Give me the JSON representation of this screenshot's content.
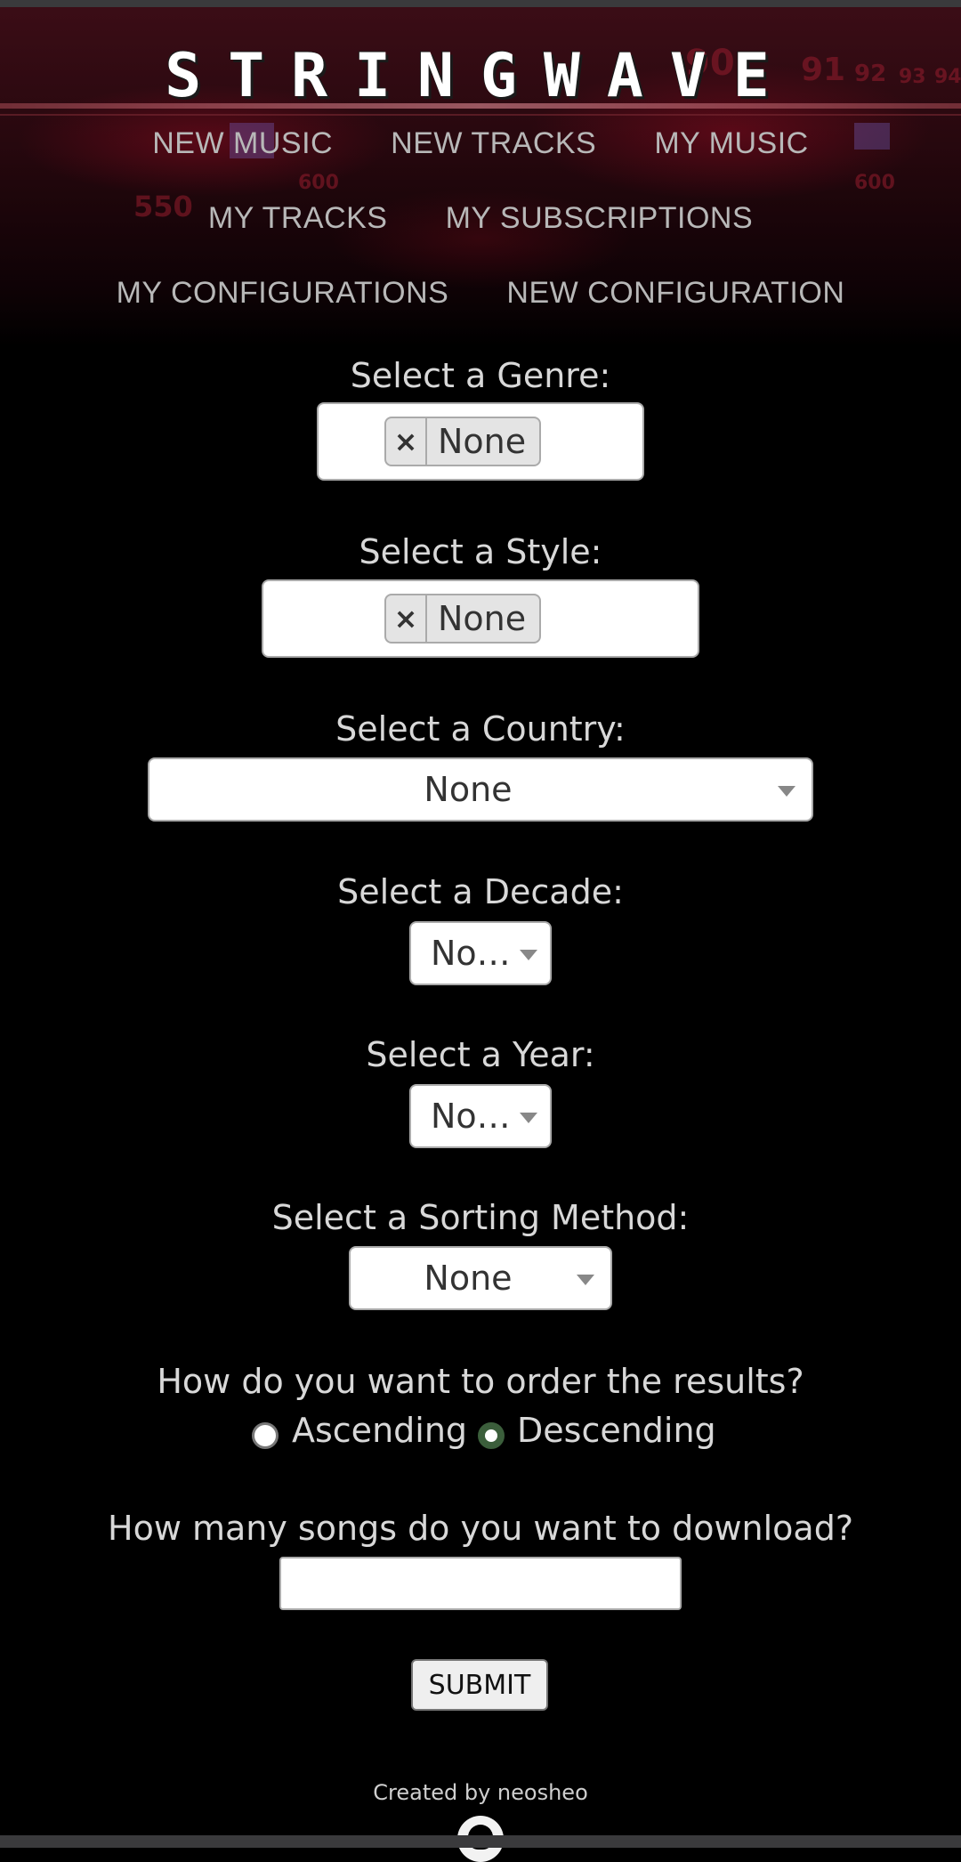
{
  "brand": {
    "logo_text": "STRINGWAVE"
  },
  "header": {
    "dial_numbers": [
      "90",
      "91",
      "92",
      "93",
      "94",
      "600",
      "550",
      "600"
    ]
  },
  "nav": {
    "row1": [
      "NEW MUSIC",
      "NEW TRACKS",
      "MY MUSIC"
    ],
    "row2": [
      "MY TRACKS",
      "MY SUBSCRIPTIONS"
    ],
    "row3": [
      "MY CONFIGURATIONS",
      "NEW CONFIGURATION"
    ]
  },
  "form": {
    "genre": {
      "label": "Select a Genre:",
      "chip_remove": "×",
      "chip_value": "None"
    },
    "style": {
      "label": "Select a Style:",
      "chip_remove": "×",
      "chip_value": "None"
    },
    "country": {
      "label": "Select a Country:",
      "value": "None"
    },
    "decade": {
      "label": "Select a Decade:",
      "value": "No…"
    },
    "year": {
      "label": "Select a Year:",
      "value": "No…"
    },
    "sorting": {
      "label": "Select a Sorting Method:",
      "value": "None"
    },
    "order": {
      "question": "How do you want to order the results?",
      "options": [
        "Ascending",
        "Descending"
      ],
      "selected": "Descending"
    },
    "count": {
      "question": "How many songs do you want to download?",
      "value": ""
    },
    "submit_label": "SUBMIT"
  },
  "footer": {
    "credit": "Created by neosheo",
    "icon": "github-icon"
  },
  "colors": {
    "background": "#000000",
    "header_red": "#3b0d16",
    "radio_selected": "#3b5e3b"
  }
}
